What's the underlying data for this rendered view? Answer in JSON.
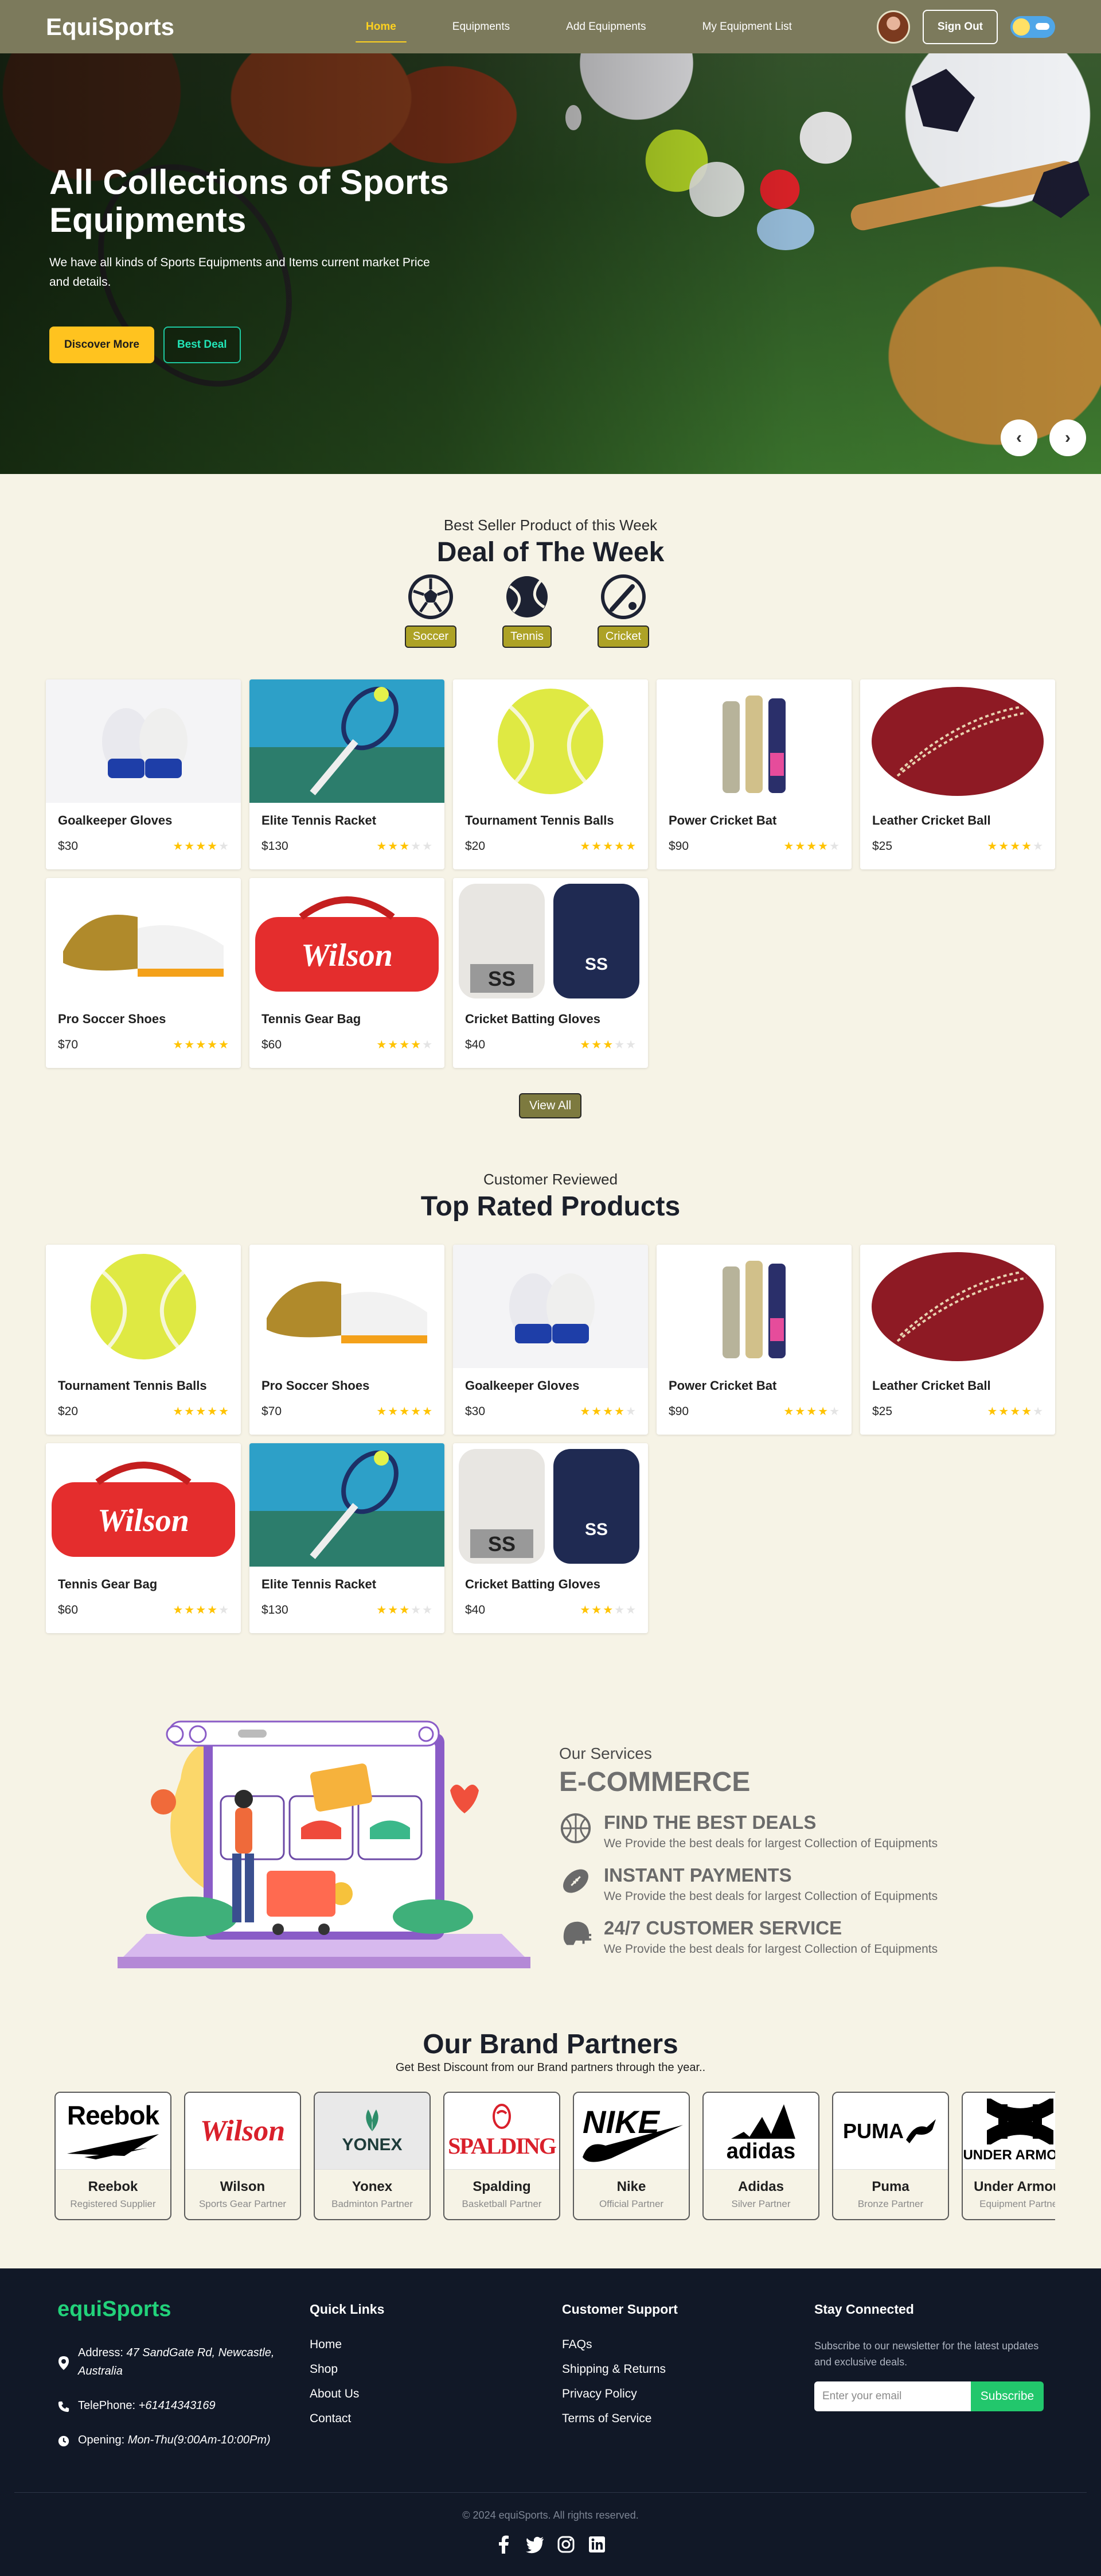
{
  "navbar": {
    "brand": "EquiSports",
    "links": [
      "Home",
      "Equipments",
      "Add Equipments",
      "My Equipment List"
    ],
    "signout": "Sign Out"
  },
  "hero": {
    "title": "All Collections of Sports Equipments",
    "subtitle": "We have all kinds of Sports Equipments and Items current market Price and details.",
    "btn_primary": "Discover More",
    "btn_secondary": "Best Deal",
    "prev": "‹",
    "next": "›"
  },
  "deal": {
    "kicker": "Best Seller Product of this Week",
    "title": "Deal of The Week",
    "categories": [
      "Soccer",
      "Tennis",
      "Cricket"
    ],
    "view_all": "View All",
    "products": [
      {
        "name": "Goalkeeper Gloves",
        "price": "$30",
        "rating": 4
      },
      {
        "name": "Elite Tennis Racket",
        "price": "$130",
        "rating": 3
      },
      {
        "name": "Tournament Tennis Balls",
        "price": "$20",
        "rating": 5
      },
      {
        "name": "Power Cricket Bat",
        "price": "$90",
        "rating": 4
      },
      {
        "name": "Leather Cricket Ball",
        "price": "$25",
        "rating": 4
      },
      {
        "name": "Pro Soccer Shoes",
        "price": "$70",
        "rating": 5
      },
      {
        "name": "Tennis Gear Bag",
        "price": "$60",
        "rating": 4
      },
      {
        "name": "Cricket Batting Gloves",
        "price": "$40",
        "rating": 3
      }
    ]
  },
  "top_rated": {
    "kicker": "Customer Reviewed",
    "title": "Top Rated Products",
    "products": [
      {
        "name": "Tournament Tennis Balls",
        "price": "$20",
        "rating": 5
      },
      {
        "name": "Pro Soccer Shoes",
        "price": "$70",
        "rating": 5
      },
      {
        "name": "Goalkeeper Gloves",
        "price": "$30",
        "rating": 4
      },
      {
        "name": "Power Cricket Bat",
        "price": "$90",
        "rating": 4
      },
      {
        "name": "Leather Cricket Ball",
        "price": "$25",
        "rating": 4
      },
      {
        "name": "Tennis Gear Bag",
        "price": "$60",
        "rating": 4
      },
      {
        "name": "Elite Tennis Racket",
        "price": "$130",
        "rating": 3
      },
      {
        "name": "Cricket Batting Gloves",
        "price": "$40",
        "rating": 3
      }
    ]
  },
  "services": {
    "kicker": "Our Services",
    "title": "E-COMMERCE",
    "items": [
      {
        "title": "FIND THE BEST DEALS",
        "desc": "We Provide the best deals for largest Collection of Equipments"
      },
      {
        "title": "INSTANT PAYMENTS",
        "desc": "We Provide the best deals for largest Collection of Equipments"
      },
      {
        "title": "24/7 CUSTOMER SERVICE",
        "desc": "We Provide the best deals for largest Collection of Equipments"
      }
    ]
  },
  "brands": {
    "title": "Our Brand Partners",
    "subtitle": "Get Best Discount from our Brand partners through the year..",
    "items": [
      {
        "name": "Reebok",
        "role": "Registered Supplier",
        "logo": "Reebok"
      },
      {
        "name": "Wilson",
        "role": "Sports Gear Partner",
        "logo": "Wilson"
      },
      {
        "name": "Yonex",
        "role": "Badminton Partner",
        "logo": "YONEX"
      },
      {
        "name": "Spalding",
        "role": "Basketball Partner",
        "logo": "SPALDING"
      },
      {
        "name": "Nike",
        "role": "Official Partner",
        "logo": "NIKE"
      },
      {
        "name": "Adidas",
        "role": "Silver Partner",
        "logo": "adidas"
      },
      {
        "name": "Puma",
        "role": "Bronze Partner",
        "logo": "PUMA"
      },
      {
        "name": "Under Armour",
        "role": "Equipment Partner",
        "logo": "UNDER ARMOUR"
      }
    ]
  },
  "footer": {
    "brand": "equiSports",
    "address_label": "Address:",
    "address": "47 SandGate Rd, Newcastle, Australia",
    "phone_label": "TelePhone:",
    "phone": "+61414343169",
    "opening_label": "Opening:",
    "opening": "Mon-Thu(9:00Am-10:00Pm)",
    "quick_links_title": "Quick Links",
    "quick_links": [
      "Home",
      "Shop",
      "About Us",
      "Contact"
    ],
    "support_title": "Customer Support",
    "support_links": [
      "FAQs",
      "Shipping & Returns",
      "Privacy Policy",
      "Terms of Service"
    ],
    "stay_title": "Stay Connected",
    "stay_text": "Subscribe to our newsletter for the latest updates and exclusive deals.",
    "email_placeholder": "Enter your email",
    "subscribe": "Subscribe",
    "copyright": "© 2024 equiSports. All rights reserved."
  },
  "colors": {
    "nav": "#7c7a5c",
    "accent_yellow": "#ffc31f",
    "star": "#ffc300",
    "footer_bg": "#111827",
    "footer_brand": "#22d27a",
    "subscribe": "#22c76c"
  }
}
